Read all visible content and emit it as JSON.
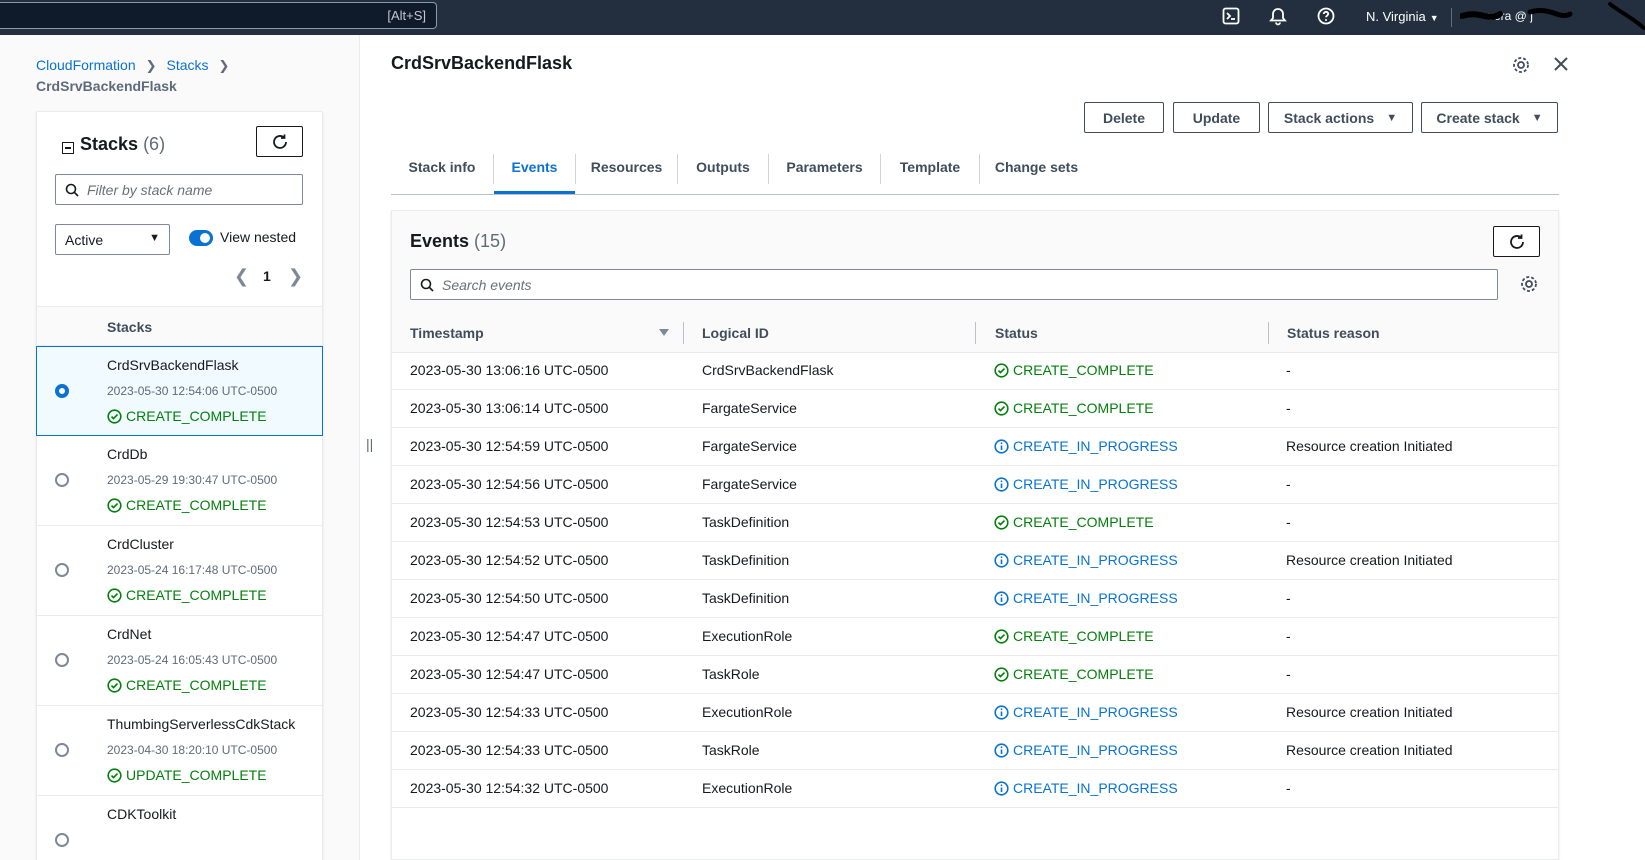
{
  "topbar": {
    "search_shortcut": "[Alt+S]",
    "region": "N. Virginia",
    "account": "vera @ j"
  },
  "breadcrumb": {
    "root": "CloudFormation",
    "section": "Stacks",
    "current": "CrdSrvBackendFlask"
  },
  "stacks_panel": {
    "title": "Stacks",
    "count": "(6)",
    "filter_placeholder": "Filter by stack name",
    "status_filter": "Active",
    "view_nested_label": "View nested",
    "page": "1",
    "column_header": "Stacks",
    "items": [
      {
        "name": "CrdSrvBackendFlask",
        "date": "2023-05-30 12:54:06 UTC-0500",
        "status": "CREATE_COMPLETE",
        "selected": true
      },
      {
        "name": "CrdDb",
        "date": "2023-05-29 19:30:47 UTC-0500",
        "status": "CREATE_COMPLETE",
        "selected": false
      },
      {
        "name": "CrdCluster",
        "date": "2023-05-24 16:17:48 UTC-0500",
        "status": "CREATE_COMPLETE",
        "selected": false
      },
      {
        "name": "CrdNet",
        "date": "2023-05-24 16:05:43 UTC-0500",
        "status": "CREATE_COMPLETE",
        "selected": false
      },
      {
        "name": "ThumbingServerlessCdkStack",
        "date": "2023-04-30 18:20:10 UTC-0500",
        "status": "UPDATE_COMPLETE",
        "selected": false
      },
      {
        "name": "CDKToolkit",
        "date": "",
        "status": "",
        "selected": false
      }
    ]
  },
  "main": {
    "title": "CrdSrvBackendFlask",
    "buttons": {
      "delete": "Delete",
      "update": "Update",
      "stack_actions": "Stack actions",
      "create_stack": "Create stack"
    },
    "tabs": [
      "Stack info",
      "Events",
      "Resources",
      "Outputs",
      "Parameters",
      "Template",
      "Change sets"
    ],
    "active_tab": "Events"
  },
  "events": {
    "title": "Events",
    "count": "(15)",
    "search_placeholder": "Search events",
    "columns": [
      "Timestamp",
      "Logical ID",
      "Status",
      "Status reason"
    ],
    "rows": [
      {
        "ts": "2023-05-30 13:06:16 UTC-0500",
        "id": "CrdSrvBackendFlask",
        "status": "CREATE_COMPLETE",
        "reason": "-"
      },
      {
        "ts": "2023-05-30 13:06:14 UTC-0500",
        "id": "FargateService",
        "status": "CREATE_COMPLETE",
        "reason": "-"
      },
      {
        "ts": "2023-05-30 12:54:59 UTC-0500",
        "id": "FargateService",
        "status": "CREATE_IN_PROGRESS",
        "reason": "Resource creation Initiated"
      },
      {
        "ts": "2023-05-30 12:54:56 UTC-0500",
        "id": "FargateService",
        "status": "CREATE_IN_PROGRESS",
        "reason": "-"
      },
      {
        "ts": "2023-05-30 12:54:53 UTC-0500",
        "id": "TaskDefinition",
        "status": "CREATE_COMPLETE",
        "reason": "-"
      },
      {
        "ts": "2023-05-30 12:54:52 UTC-0500",
        "id": "TaskDefinition",
        "status": "CREATE_IN_PROGRESS",
        "reason": "Resource creation Initiated"
      },
      {
        "ts": "2023-05-30 12:54:50 UTC-0500",
        "id": "TaskDefinition",
        "status": "CREATE_IN_PROGRESS",
        "reason": "-"
      },
      {
        "ts": "2023-05-30 12:54:47 UTC-0500",
        "id": "ExecutionRole",
        "status": "CREATE_COMPLETE",
        "reason": "-"
      },
      {
        "ts": "2023-05-30 12:54:47 UTC-0500",
        "id": "TaskRole",
        "status": "CREATE_COMPLETE",
        "reason": "-"
      },
      {
        "ts": "2023-05-30 12:54:33 UTC-0500",
        "id": "ExecutionRole",
        "status": "CREATE_IN_PROGRESS",
        "reason": "Resource creation Initiated"
      },
      {
        "ts": "2023-05-30 12:54:33 UTC-0500",
        "id": "TaskRole",
        "status": "CREATE_IN_PROGRESS",
        "reason": "Resource creation Initiated"
      },
      {
        "ts": "2023-05-30 12:54:32 UTC-0500",
        "id": "ExecutionRole",
        "status": "CREATE_IN_PROGRESS",
        "reason": "-"
      }
    ]
  },
  "colors": {
    "topbar_bg": "#232f3e",
    "link_blue": "#0972d3",
    "success_green": "#037f0c",
    "text_dark": "#16191f"
  },
  "icons": [
    "cloudshell-icon",
    "bell-icon",
    "help-icon",
    "refresh-icon",
    "search-icon",
    "gear-icon",
    "close-icon",
    "check-circle-icon",
    "info-circle-icon"
  ]
}
